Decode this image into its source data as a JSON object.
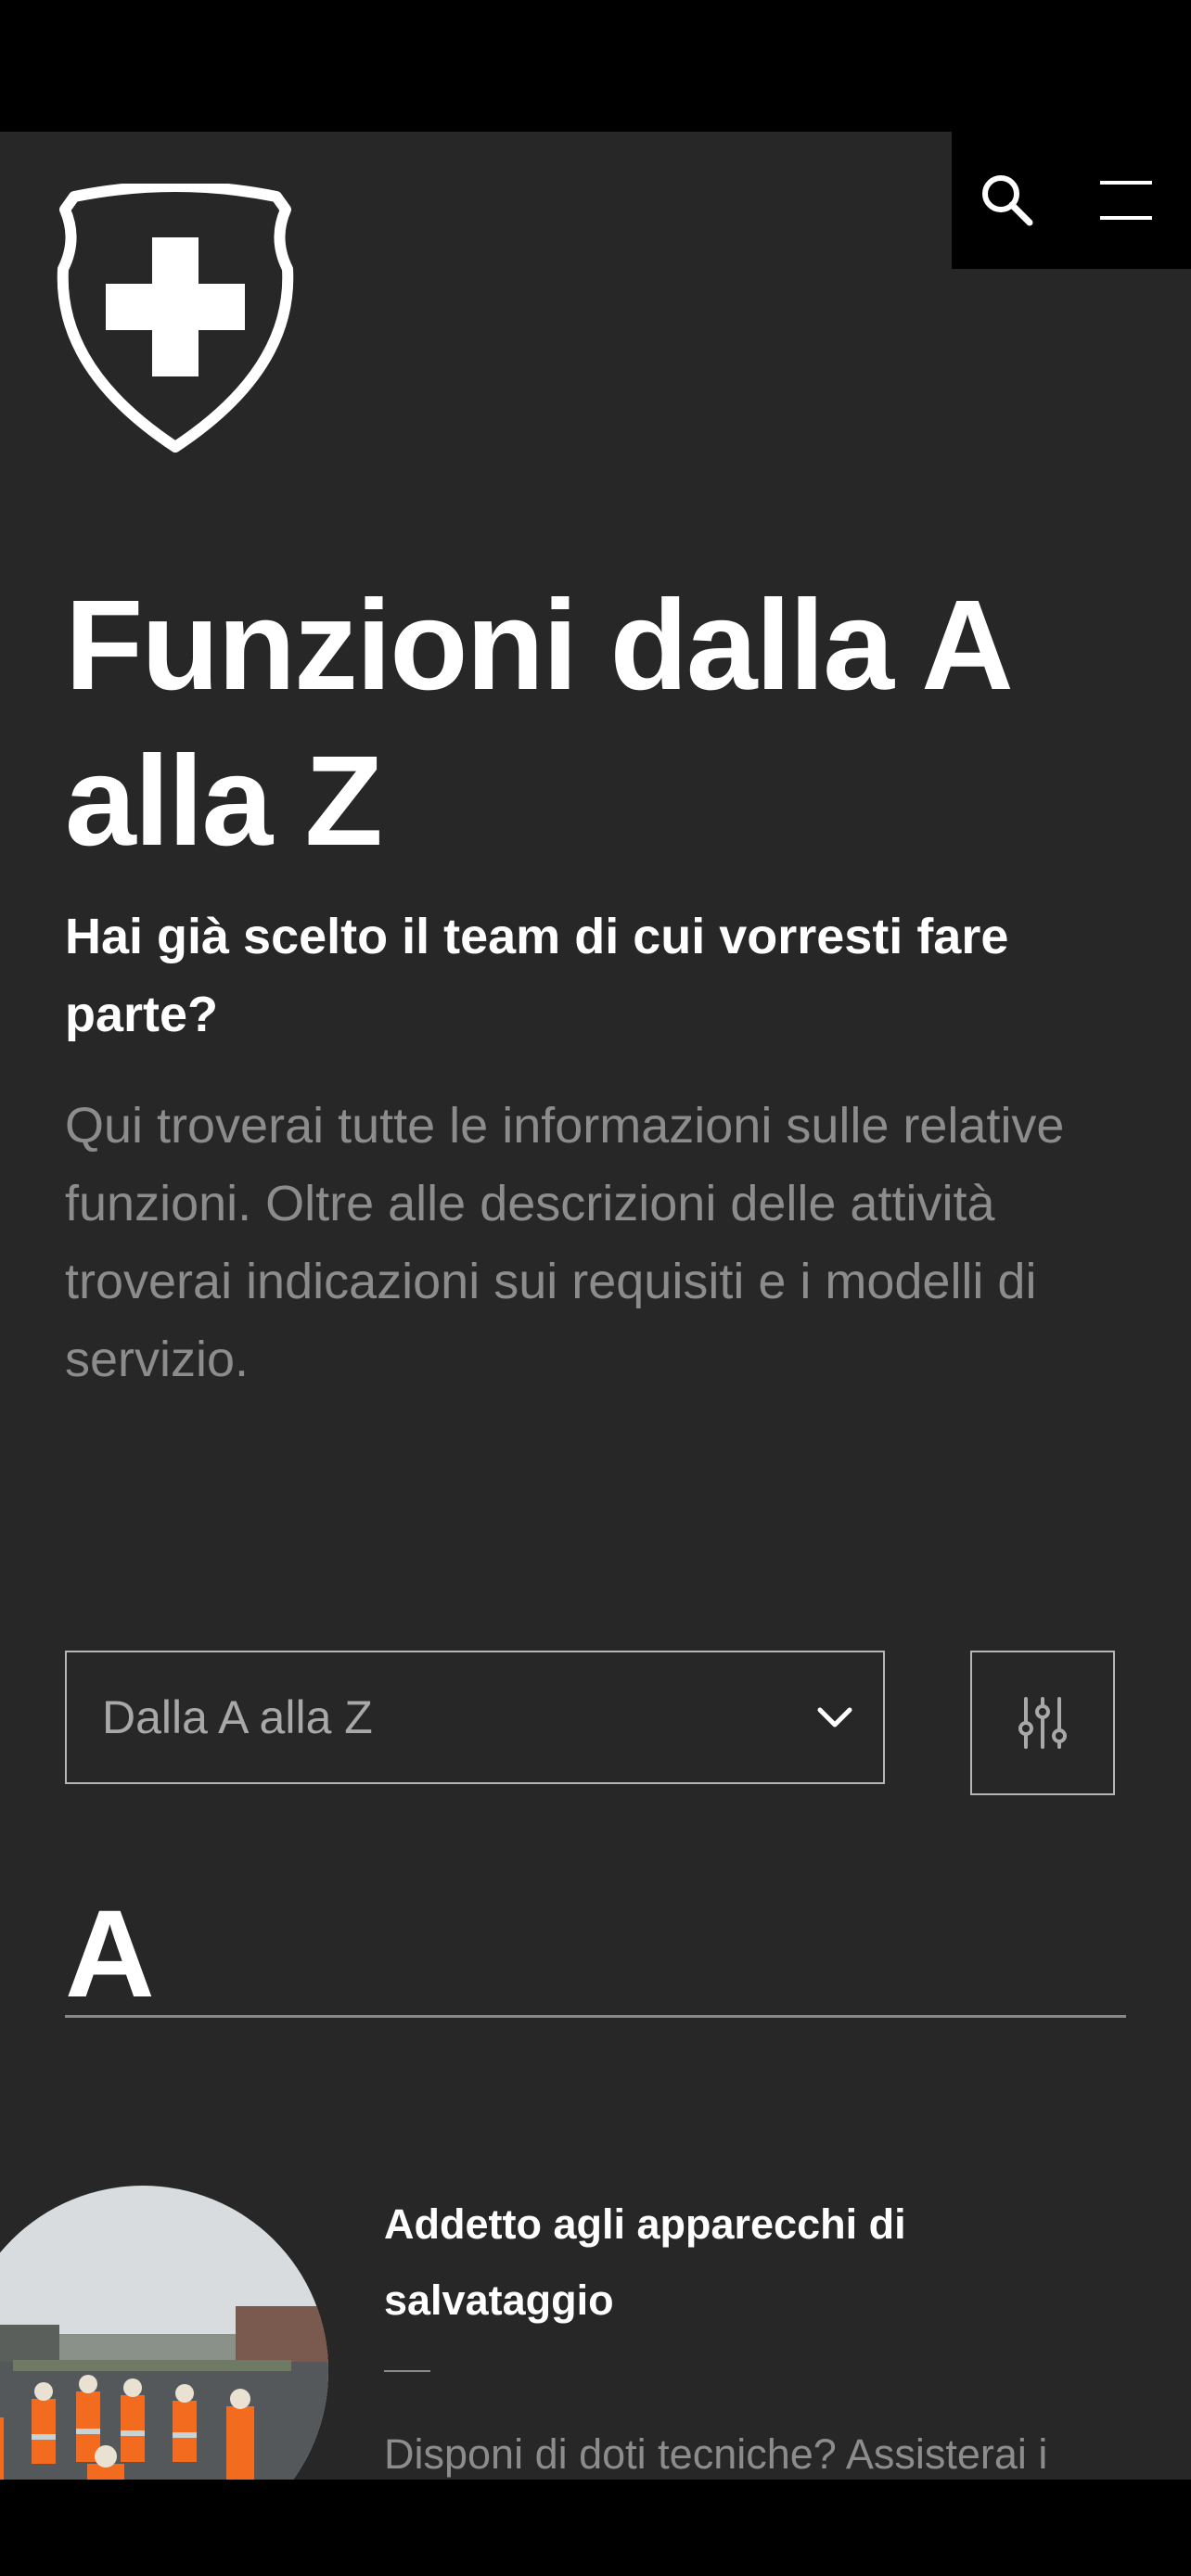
{
  "header": {
    "search_icon": "search-icon",
    "menu_icon": "hamburger-menu-icon",
    "logo_icon": "swiss-cross-shield-icon"
  },
  "hero": {
    "title": "Funzioni dalla A alla Z",
    "subtitle": "Hai già scelto il team di cui vorresti fare parte?",
    "description": "Qui troverai tutte le informazioni sulle relative funzioni. Oltre alle descrizioni delle attività troverai indicazioni sui requisiti e i modelli di servizio."
  },
  "controls": {
    "sort_selected": "Dalla A alla Z",
    "sort_icon": "chevron-down-icon",
    "filter_icon": "sliders-filter-icon"
  },
  "sections": [
    {
      "letter": "A",
      "items": [
        {
          "title": "Addetto agli apparecchi di salvataggio",
          "description": "Disponi di doti tecniche? Assisterai i"
        }
      ]
    }
  ],
  "colors": {
    "background": "#272727",
    "bars": "#000000",
    "text_primary": "#ffffff",
    "text_secondary": "#8c8c8c"
  }
}
